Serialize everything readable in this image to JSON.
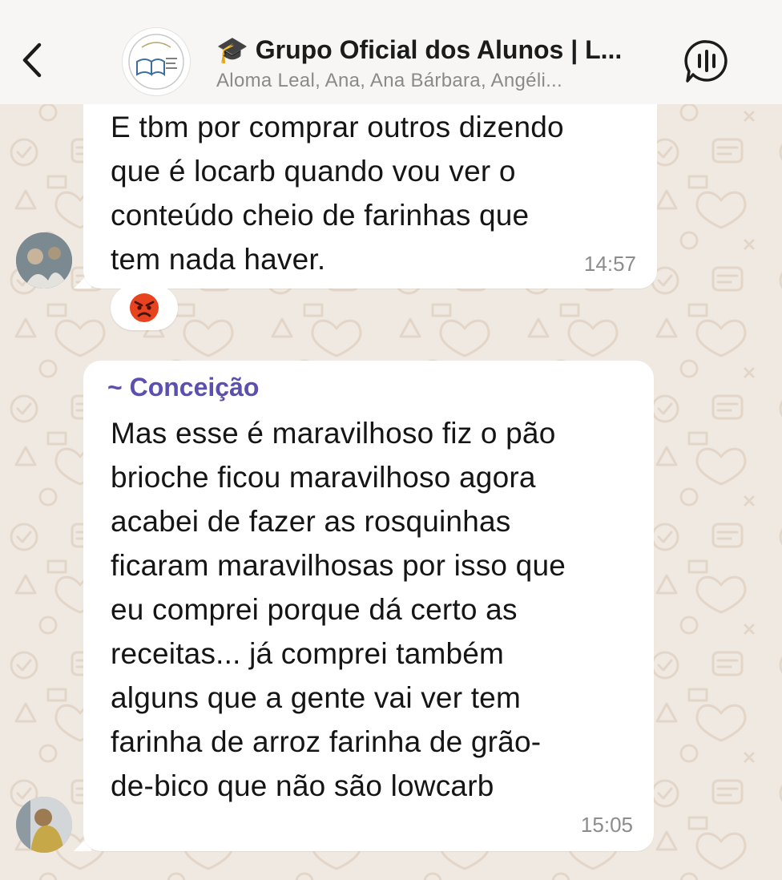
{
  "header": {
    "back_icon": "chevron-left-icon",
    "group_avatar_icon": "group-logo",
    "title_emoji": "🎓",
    "title": "Grupo Oficial dos Alunos | L...",
    "members": "Aloma Leal, Ana, Ana Bárbara, Angéli...",
    "call_icon": "voice-call-icon"
  },
  "messages": [
    {
      "text": "E tbm por comprar outros dizendo\nque é locarb   quando vou ver o\nconteúdo cheio de farinhas que\ntem nada haver.",
      "time": "14:57",
      "reaction": "😡"
    },
    {
      "sender": "~ Conceição",
      "text": "Mas esse é maravilhoso fiz o pão\nbrioche ficou maravilhoso agora\nacabei de fazer as rosquinhas\nficaram maravilhosas por isso que\neu comprei porque dá certo as\nreceitas... já comprei também\nalguns que a gente vai ver tem\nfarinha de arroz farinha de grão-\nde-bico que não são lowcarb",
      "time": "15:05"
    }
  ],
  "colors": {
    "wallpaper": "#efe9e1",
    "header": "#f7f6f4",
    "sender_name": "#5b4fb0",
    "timestamp": "#8c8c8c"
  }
}
